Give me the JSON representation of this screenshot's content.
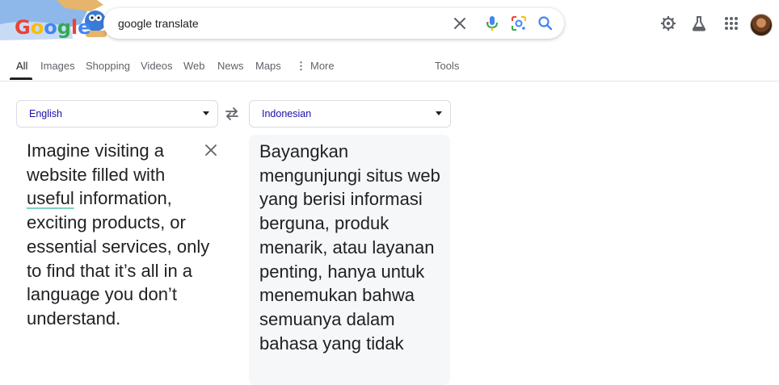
{
  "search": {
    "query": "google translate"
  },
  "tabs": [
    {
      "label": "All"
    },
    {
      "label": "Images"
    },
    {
      "label": "Shopping"
    },
    {
      "label": "Videos"
    },
    {
      "label": "Web"
    },
    {
      "label": "News"
    },
    {
      "label": "Maps"
    },
    {
      "label": "More"
    }
  ],
  "tools_label": "Tools",
  "translate": {
    "source_language": "English",
    "target_language": "Indonesian",
    "source_text_before": "Imagine visiting a website filled with",
    "source_text_highlight": "useful",
    "source_text_after": "information, exciting products, or essential services, only to find that it’s all in a language you don’t understand.",
    "target_text": "Bayangkan mengunjungi situs web yang berisi informasi berguna, produk menarik, atau layanan penting, hanya untuk menemukan bahwa semuanya dalam bahasa yang tidak"
  },
  "icons": {
    "clear": "close-icon",
    "voice": "microphone-icon",
    "lens": "camera-lens-icon",
    "search": "search-icon",
    "settings": "gear-icon",
    "labs": "flask-icon",
    "apps": "grid-icon",
    "swap": "swap-arrows-icon",
    "source_clear": "close-icon"
  },
  "colors": {
    "link_blue": "#1a0dab",
    "google_blue": "#4285f4",
    "google_red": "#ea4335",
    "google_yellow": "#fbbc05",
    "google_green": "#34a853"
  }
}
